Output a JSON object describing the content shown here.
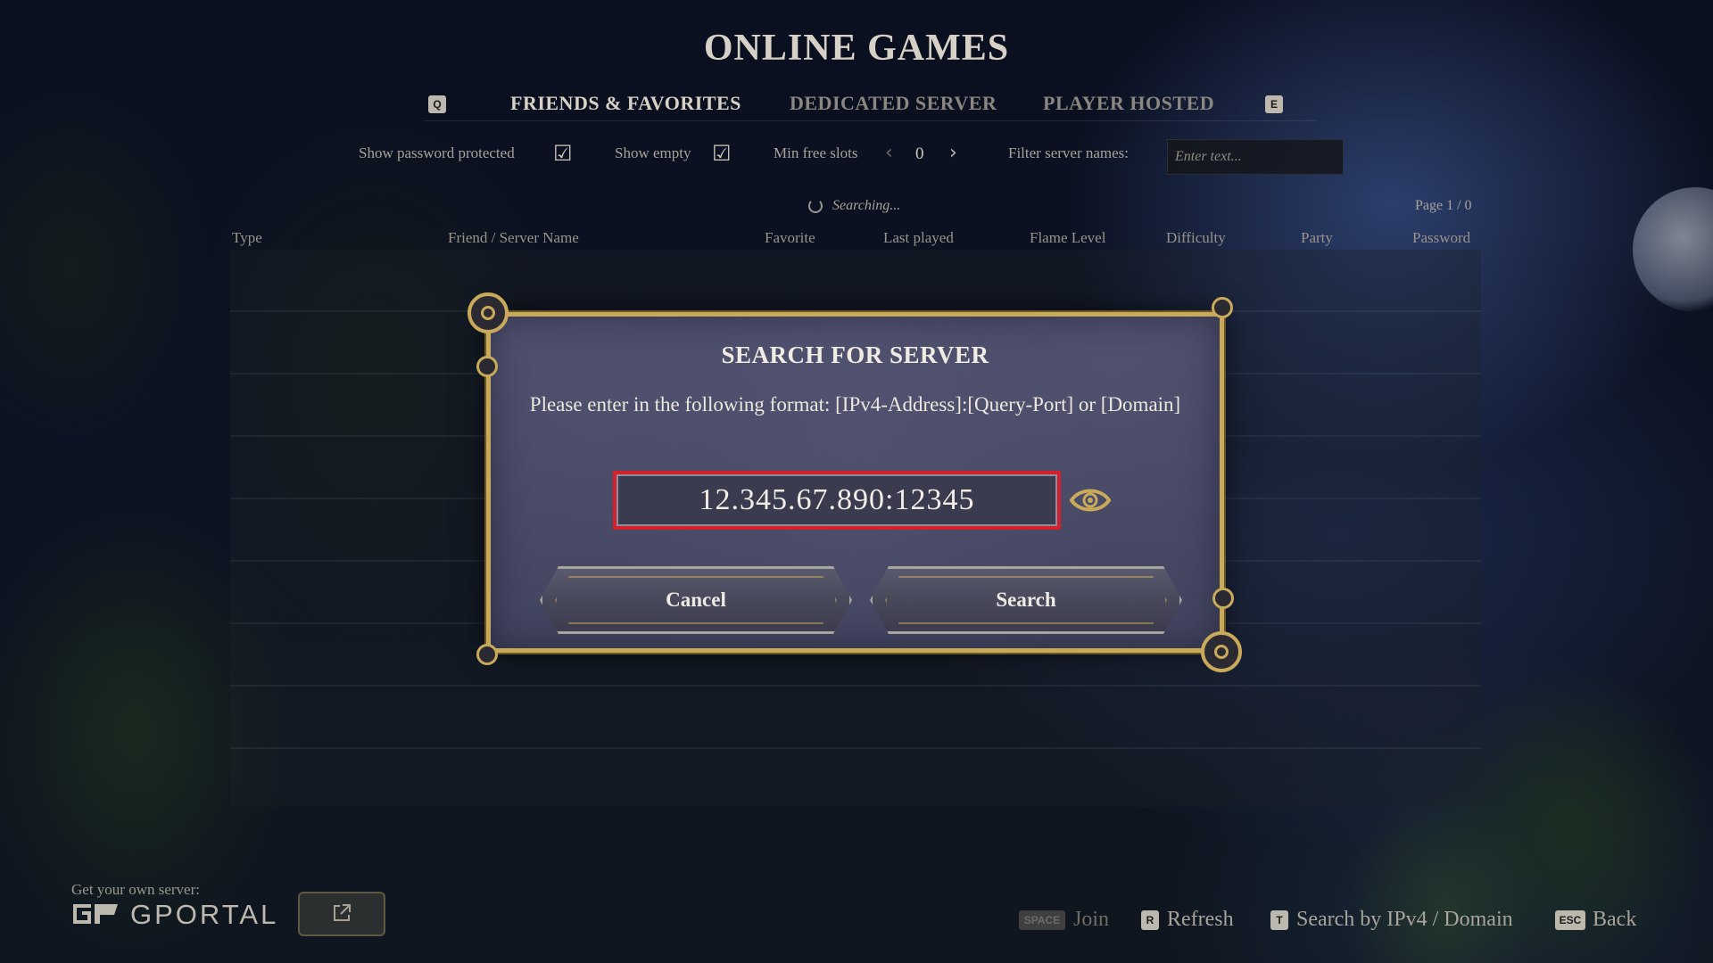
{
  "header": {
    "title": "ONLINE GAMES",
    "tab_prev_key": "Q",
    "tab_next_key": "E",
    "tabs": [
      {
        "label": "FRIENDS & FAVORITES",
        "active": true
      },
      {
        "label": "DEDICATED SERVER",
        "active": false
      },
      {
        "label": "PLAYER HOSTED",
        "active": false
      }
    ]
  },
  "filters": {
    "show_password_protected_label": "Show password protected",
    "show_password_protected_checked": true,
    "show_empty_label": "Show empty",
    "show_empty_checked": true,
    "min_free_slots_label": "Min free slots",
    "min_free_slots_value": "0",
    "filter_names_label": "Filter server names:",
    "filter_names_placeholder": "Enter text..."
  },
  "status": {
    "searching_text": "Searching...",
    "page_text": "Page 1 / 0"
  },
  "columns": [
    "Type",
    "Friend / Server Name",
    "Favorite",
    "Last played",
    "Flame Level",
    "Difficulty",
    "Party",
    "Password"
  ],
  "modal": {
    "title": "SEARCH FOR SERVER",
    "description": "Please enter in the following format: [IPv4-Address]:[Query-Port] or [Domain]",
    "input_value": "12.345.67.890:12345",
    "cancel_label": "Cancel",
    "search_label": "Search"
  },
  "footer": {
    "own_server_text": "Get your own server:",
    "gportal_text": "GPORTAL",
    "hints": [
      {
        "key": "SPACE",
        "label": "Join",
        "enabled": false
      },
      {
        "key": "R",
        "label": "Refresh",
        "enabled": true
      },
      {
        "key": "T",
        "label": "Search by IPv4 / Domain",
        "enabled": true
      },
      {
        "key": "ESC",
        "label": "Back",
        "enabled": true
      }
    ]
  },
  "colors": {
    "accent_gold": "#c9aa5a",
    "input_highlight": "#d4202a",
    "modal_bg": "#45465f"
  }
}
